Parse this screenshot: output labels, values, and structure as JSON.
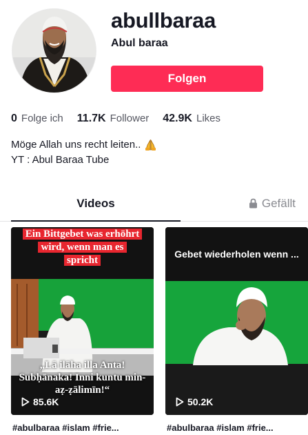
{
  "profile": {
    "username": "abullbaraa",
    "nickname": "Abul baraa",
    "follow_label": "Folgen"
  },
  "stats": [
    {
      "value": "0",
      "label": "Folge ich"
    },
    {
      "value": "11.7K",
      "label": "Follower"
    },
    {
      "value": "42.9K",
      "label": "Likes"
    }
  ],
  "bio": {
    "line1": "Möge Allah uns recht leiten..",
    "line1_emoji": "folded-hands-icon",
    "line2": "YT : Abul Baraa Tube"
  },
  "tabs": {
    "videos": "Videos",
    "liked": "Gefällt"
  },
  "videos": [
    {
      "overlay_top": "Ein Bittgebet was erhöhrt wird, wenn man es spricht",
      "overlay_bottom": "„Lā ilāha illa Anta! Subḥānaka! Inni kuntu min-aẓ-ẓālimīn!“",
      "views": "85.6K",
      "caption": "#abulbaraa #islam #frie..."
    },
    {
      "overlay_top": "Gebet wiederholen wenn ...",
      "views": "50.2K",
      "caption": "#abulbaraa #islam #frie..."
    }
  ],
  "colors": {
    "accent": "#fe2c55",
    "text": "#161823",
    "muted": "#545660",
    "tab_inactive": "#8a8b91",
    "overlay_red": "#e8262f",
    "green_screen": "#17a23a"
  }
}
